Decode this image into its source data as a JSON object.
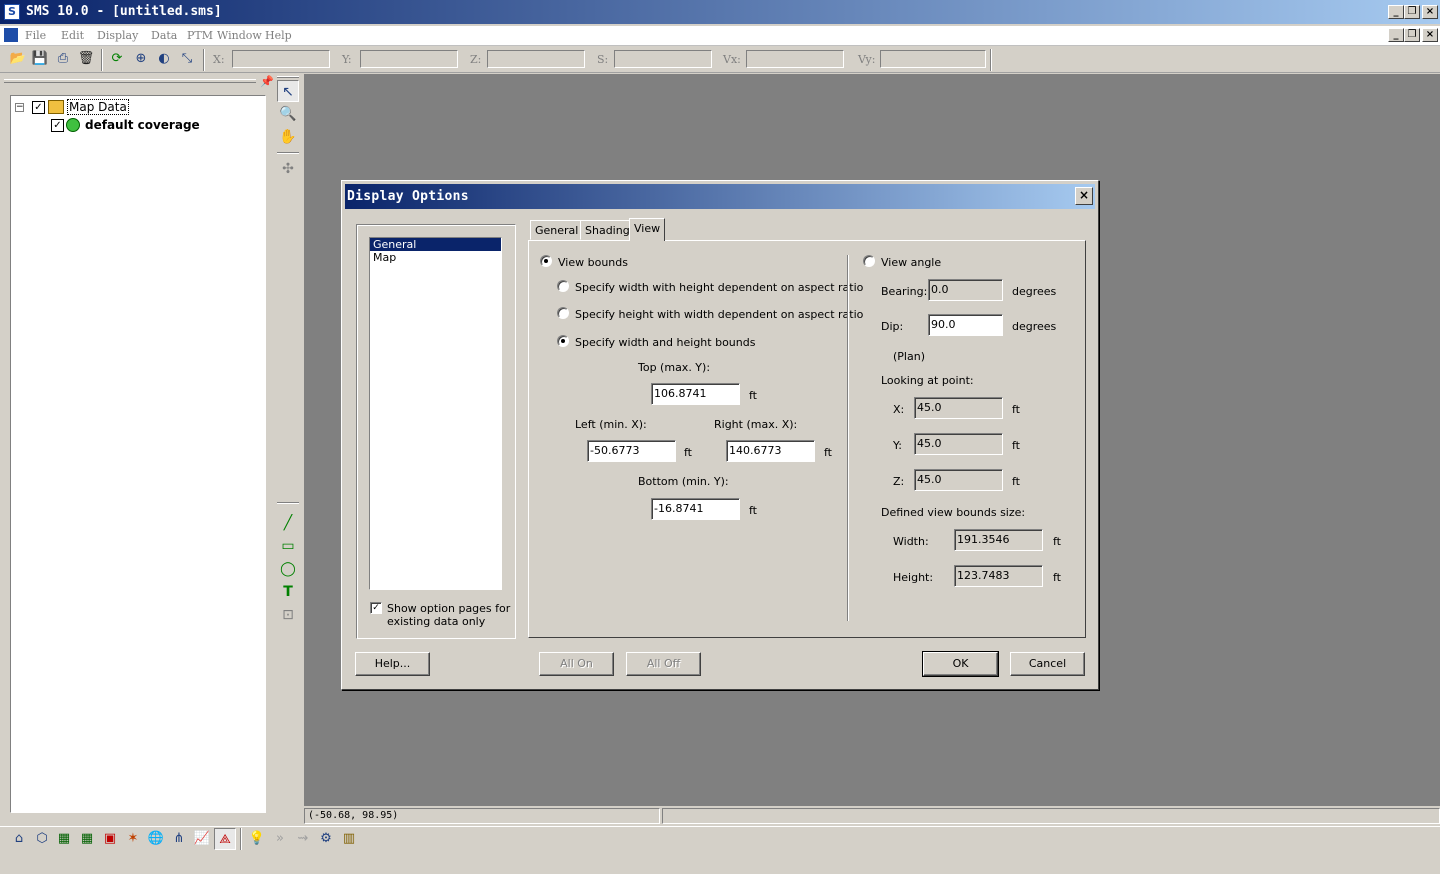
{
  "app": {
    "title": "SMS 10.0 - [untitled.sms]",
    "icon": "sms-app-icon"
  },
  "menu": [
    "File",
    "Edit",
    "Display",
    "Data",
    "PTM",
    "Window",
    "Help"
  ],
  "toolbar": {
    "coords": [
      {
        "label": "X:",
        "value": ""
      },
      {
        "label": "Y:",
        "value": ""
      },
      {
        "label": "Z:",
        "value": ""
      },
      {
        "label": "S:",
        "value": ""
      },
      {
        "label": "Vx:",
        "value": ""
      },
      {
        "label": "Vy:",
        "value": ""
      }
    ]
  },
  "tree": {
    "root": {
      "label": "Map Data",
      "checked": true,
      "expander": "−"
    },
    "child": {
      "label": "default coverage",
      "checked": true
    }
  },
  "status": {
    "coords": "(-50.68, 98.95)"
  },
  "dialog": {
    "title": "Display Options",
    "close": "×",
    "list": [
      "General",
      "Map"
    ],
    "selected_index": 0,
    "show_option_pages": {
      "label_line1": "Show option pages for",
      "label_line2": "existing data only",
      "checked": true
    },
    "tabs": [
      "General",
      "Shading",
      "View"
    ],
    "active_tab": "View",
    "view": {
      "view_bounds_label": "View bounds",
      "opt_width": "Specify width with height dependent on aspect ratio",
      "opt_height": "Specify height with width dependent on aspect ratio",
      "opt_both": "Specify width and height bounds",
      "top_label": "Top (max. Y):",
      "top_value": "106.8741",
      "left_label": "Left (min. X):",
      "left_value": "-50.6773",
      "right_label": "Right (max. X):",
      "right_value": "140.6773",
      "bottom_label": "Bottom (min. Y):",
      "bottom_value": "-16.8741",
      "unit": "ft",
      "view_angle_label": "View angle",
      "bearing_label": "Bearing:",
      "bearing_value": "0.0",
      "dip_label": "Dip:",
      "dip_value": "90.0",
      "degrees": "degrees",
      "plan": "(Plan)",
      "looking_at": "Looking at point:",
      "x_label": "X:",
      "x_value": "45.0",
      "y_label": "Y:",
      "y_value": "45.0",
      "z_label": "Z:",
      "z_value": "45.0",
      "defined_size": "Defined view bounds size:",
      "width_label": "Width:",
      "width_value": "191.3546",
      "height_label": "Height:",
      "height_value": "123.7483"
    },
    "buttons": {
      "help": "Help...",
      "all_on": "All On",
      "all_off": "All Off",
      "ok": "OK",
      "cancel": "Cancel"
    }
  }
}
